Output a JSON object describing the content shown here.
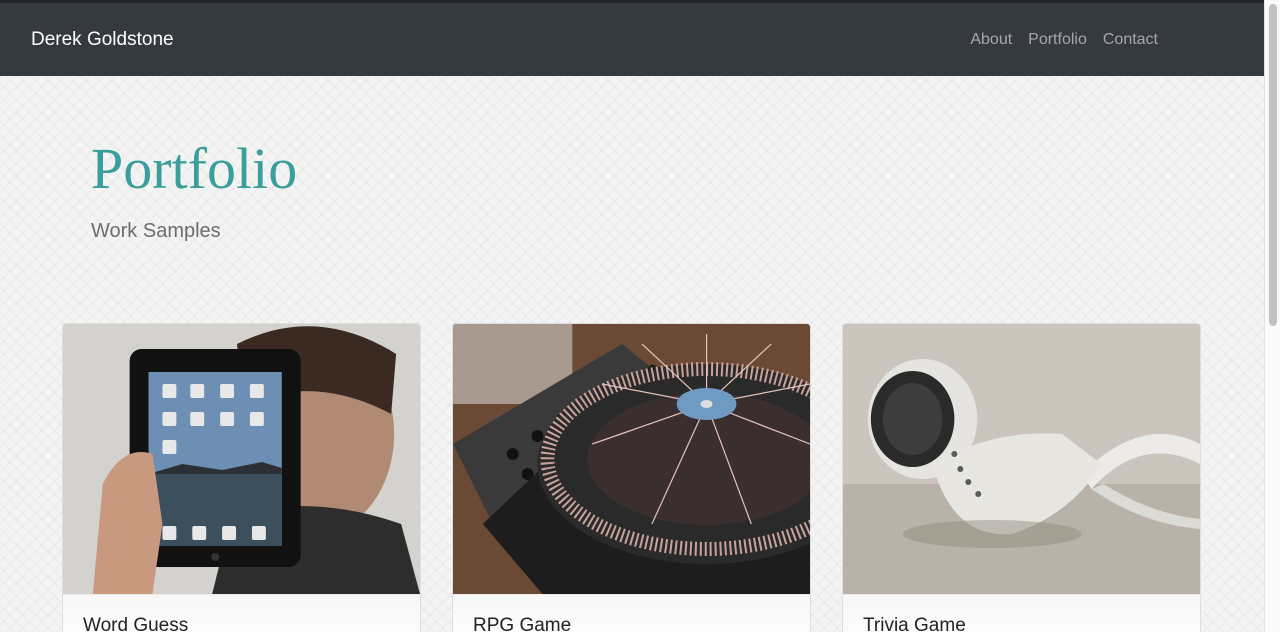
{
  "navbar": {
    "brand": "Derek Goldstone",
    "links": [
      {
        "label": "About"
      },
      {
        "label": "Portfolio"
      },
      {
        "label": "Contact"
      }
    ]
  },
  "hero": {
    "title": "Portfolio",
    "subtitle": "Work Samples"
  },
  "cards": [
    {
      "title": "Word Guess",
      "image": "person-holding-tablet-photo"
    },
    {
      "title": "RPG Game",
      "image": "turntable-mixer-photo"
    },
    {
      "title": "Trivia Game",
      "image": "earbuds-photo"
    }
  ]
}
